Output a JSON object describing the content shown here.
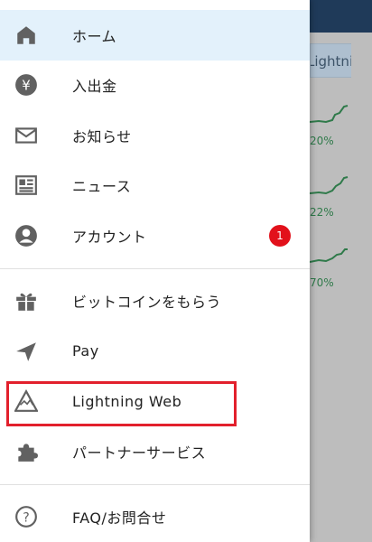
{
  "background": {
    "chip_label": "Lightning",
    "percents": [
      "20%",
      "22%",
      "70%"
    ]
  },
  "drawer": {
    "items_group1": [
      {
        "icon": "home-icon",
        "label": "ホーム",
        "active": true
      },
      {
        "icon": "yen-icon",
        "label": "入出金"
      },
      {
        "icon": "mail-icon",
        "label": "お知らせ"
      },
      {
        "icon": "news-icon",
        "label": "ニュース"
      },
      {
        "icon": "account-icon",
        "label": "アカウント",
        "badge": "1"
      }
    ],
    "items_group2": [
      {
        "icon": "gift-icon",
        "label": "ビットコインをもらう"
      },
      {
        "icon": "send-icon",
        "label": "Pay"
      },
      {
        "icon": "lightning-web-icon",
        "label": "Lightning Web",
        "highlighted": true
      },
      {
        "icon": "puzzle-icon",
        "label": "パートナーサービス"
      }
    ],
    "items_group3": [
      {
        "icon": "help-icon",
        "label": "FAQ/お問合せ"
      }
    ]
  },
  "colors": {
    "active_bg": "#e3f1fb",
    "badge": "#e2111b",
    "highlight": "#e2202c"
  }
}
